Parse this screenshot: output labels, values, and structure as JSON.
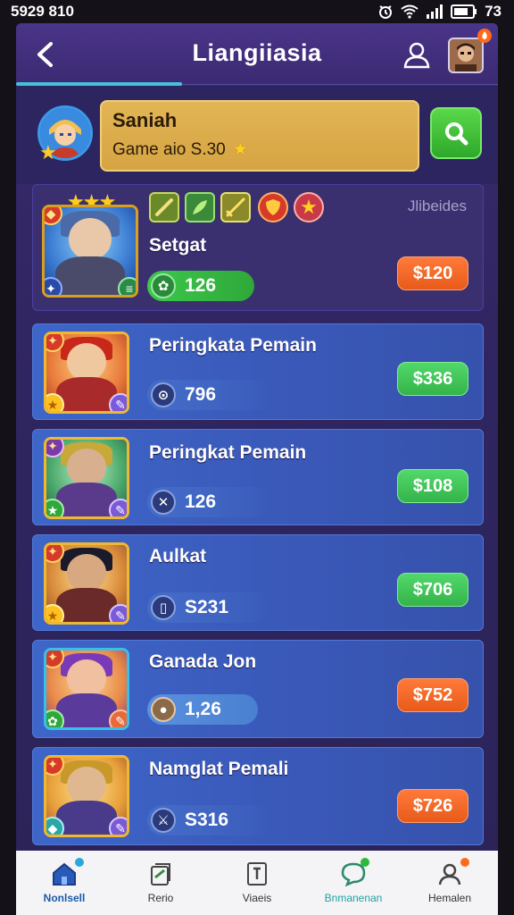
{
  "status_bar": {
    "time": "5929 810",
    "battery": "73"
  },
  "header": {
    "title": "Liangiiasia"
  },
  "user": {
    "name": "Saniah",
    "game_label": "Game aio S.30",
    "star": "★"
  },
  "players": [
    {
      "stars": "★★★",
      "name": "Setgat",
      "score": "126",
      "price": "$120",
      "corner_label": "Jlibeides",
      "equip_icons": [
        "sword-icon",
        "leaf-blade-icon",
        "golden-blade-icon",
        "red-shield-icon",
        "star-medal-icon"
      ]
    },
    {
      "name": "Peringkata Pemain",
      "score": "796",
      "price": "$336"
    },
    {
      "name": "Peringkat Pemain",
      "score": "126",
      "price": "$108"
    },
    {
      "name": "Aulkat",
      "score": "S231",
      "price": "$706"
    },
    {
      "name": "Ganada Jon",
      "score": "1,26",
      "price": "$752"
    },
    {
      "name": "Namglat Pemali",
      "score": "S316",
      "price": "$726"
    }
  ],
  "colors": {
    "accent": "#46c2d8",
    "orange": "#ff7a3a",
    "green": "#3ec84a",
    "gold": "#e2b555"
  },
  "bottom_nav": [
    {
      "label": "Nonlsell",
      "icon": "home-icon"
    },
    {
      "label": "Rerio",
      "icon": "cards-icon"
    },
    {
      "label": "Viaeis",
      "icon": "document-icon"
    },
    {
      "label": "Bnmanenan",
      "icon": "chat-icon"
    },
    {
      "label": "Hemalen",
      "icon": "profile-icon"
    }
  ]
}
